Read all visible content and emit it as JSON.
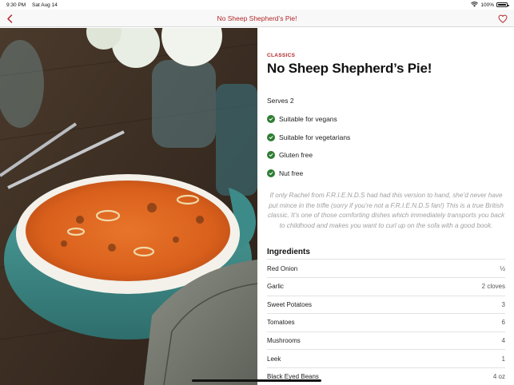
{
  "status_bar": {
    "time": "9:30 PM",
    "date": "Sat Aug 14",
    "battery": "100%",
    "battery_level": 1.0
  },
  "nav": {
    "title": "No Sheep Shepherd’s Pie!"
  },
  "recipe": {
    "category": "CLASSICS",
    "title": "No Sheep Shepherd’s Pie!",
    "serves": "Serves 2",
    "diet": [
      {
        "label": "Suitable for vegans"
      },
      {
        "label": "Suitable for vegetarians"
      },
      {
        "label": "Gluten free"
      },
      {
        "label": "Nut free"
      }
    ],
    "description": "If only Rachel from F.R.I.E.N.D.S had had this version to hand, she’d never have put mince in the trifle (sorry if you’re not a F.R.I.E.N.D.S fan!) This is a true British classic. It’s one of those comforting dishes which immediately transports you back to childhood and makes you want to curl up on the sofa with a good book."
  },
  "ingredients": {
    "heading": "Ingredients",
    "items": [
      {
        "name": "Red Onion",
        "qty": "½"
      },
      {
        "name": "Garlic",
        "qty": "2 cloves"
      },
      {
        "name": "Sweet Potatoes",
        "qty": "3"
      },
      {
        "name": "Tomatoes",
        "qty": "6"
      },
      {
        "name": "Mushrooms",
        "qty": "4"
      },
      {
        "name": "Leek",
        "qty": "1"
      },
      {
        "name": "Black Eyed Beans",
        "qty": "4 oz"
      }
    ]
  },
  "colors": {
    "accent": "#b3262b",
    "check": "#2e7d32",
    "description": "#a0a0a0"
  },
  "icons": [
    "back-chevron-icon",
    "heart-icon",
    "wifi-icon",
    "battery-icon",
    "checkmark-icon"
  ]
}
